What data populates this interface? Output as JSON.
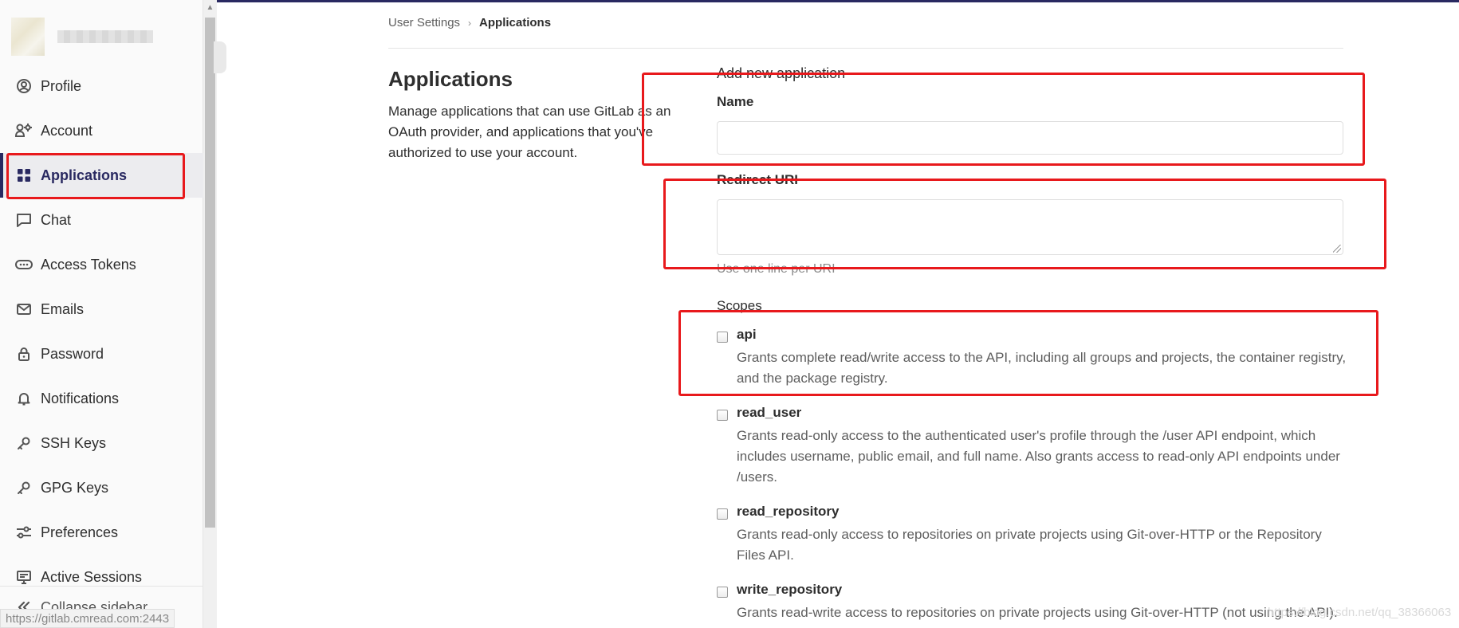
{
  "sidebar": {
    "items": [
      {
        "label": "Profile",
        "icon": "profile-icon"
      },
      {
        "label": "Account",
        "icon": "account-icon"
      },
      {
        "label": "Applications",
        "icon": "applications-icon",
        "active": true
      },
      {
        "label": "Chat",
        "icon": "chat-icon"
      },
      {
        "label": "Access Tokens",
        "icon": "token-icon"
      },
      {
        "label": "Emails",
        "icon": "mail-icon"
      },
      {
        "label": "Password",
        "icon": "lock-icon"
      },
      {
        "label": "Notifications",
        "icon": "bell-icon"
      },
      {
        "label": "SSH Keys",
        "icon": "key-icon"
      },
      {
        "label": "GPG Keys",
        "icon": "key-icon"
      },
      {
        "label": "Preferences",
        "icon": "preferences-icon"
      },
      {
        "label": "Active Sessions",
        "icon": "monitor-icon"
      }
    ],
    "collapse_label": "Collapse sidebar"
  },
  "status_url": "https://gitlab.cmread.com:2443",
  "breadcrumb": {
    "parent": "User Settings",
    "current": "Applications"
  },
  "page": {
    "title": "Applications",
    "description": "Manage applications that can use GitLab as an OAuth provider, and applications that you've authorized to use your account."
  },
  "form": {
    "heading": "Add new application",
    "name_label": "Name",
    "name_value": "",
    "redirect_label": "Redirect URI",
    "redirect_value": "",
    "redirect_hint": "Use one line per URI",
    "scopes_label": "Scopes",
    "scopes": [
      {
        "name": "api",
        "checked": false,
        "description": "Grants complete read/write access to the API, including all groups and projects, the container registry, and the package registry."
      },
      {
        "name": "read_user",
        "checked": false,
        "description": "Grants read-only access to the authenticated user's profile through the /user API endpoint, which includes username, public email, and full name. Also grants access to read-only API endpoints under /users."
      },
      {
        "name": "read_repository",
        "checked": false,
        "description": "Grants read-only access to repositories on private projects using Git-over-HTTP or the Repository Files API."
      },
      {
        "name": "write_repository",
        "checked": false,
        "description": "Grants read-write access to repositories on private projects using Git-over-HTTP (not using the API)."
      }
    ]
  },
  "watermark": "https://blog.csdn.net/qq_38366063",
  "colors": {
    "nav_active": "#292961",
    "annotation_red": "#e8191c"
  }
}
